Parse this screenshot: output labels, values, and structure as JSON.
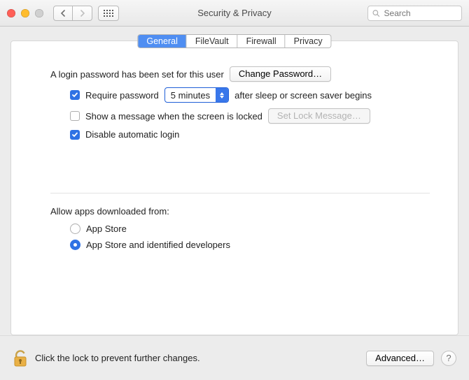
{
  "window": {
    "title": "Security & Privacy"
  },
  "search": {
    "placeholder": "Search"
  },
  "tabs": [
    "General",
    "FileVault",
    "Firewall",
    "Privacy"
  ],
  "login": {
    "intro": "A login password has been set for this user",
    "change_button": "Change Password…",
    "require_label_left": "Require password",
    "require_dropdown": "5 minutes",
    "require_label_right": "after sleep or screen saver begins",
    "show_msg_label": "Show a message when the screen is locked",
    "set_lock_msg_button": "Set Lock Message…",
    "disable_auto_login": "Disable automatic login",
    "require_checked": true,
    "show_msg_checked": false,
    "disable_auto_checked": true
  },
  "download": {
    "heading": "Allow apps downloaded from:",
    "options": [
      "App Store",
      "App Store and identified developers"
    ],
    "selected": 1
  },
  "footer": {
    "lock_text": "Click the lock to prevent further changes.",
    "advanced": "Advanced…"
  }
}
